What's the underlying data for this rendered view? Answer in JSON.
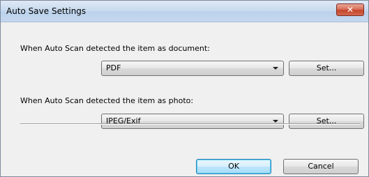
{
  "window": {
    "title": "Auto Save Settings",
    "close_label": "✕"
  },
  "document_section": {
    "label": "When Auto Scan detected the item as document:",
    "format_value": "PDF",
    "set_button": "Set..."
  },
  "photo_section": {
    "label": "When Auto Scan detected the item as photo:",
    "format_value": "JPEG/Exif",
    "set_button": "Set..."
  },
  "footer": {
    "ok_button": "OK",
    "cancel_button": "Cancel"
  }
}
